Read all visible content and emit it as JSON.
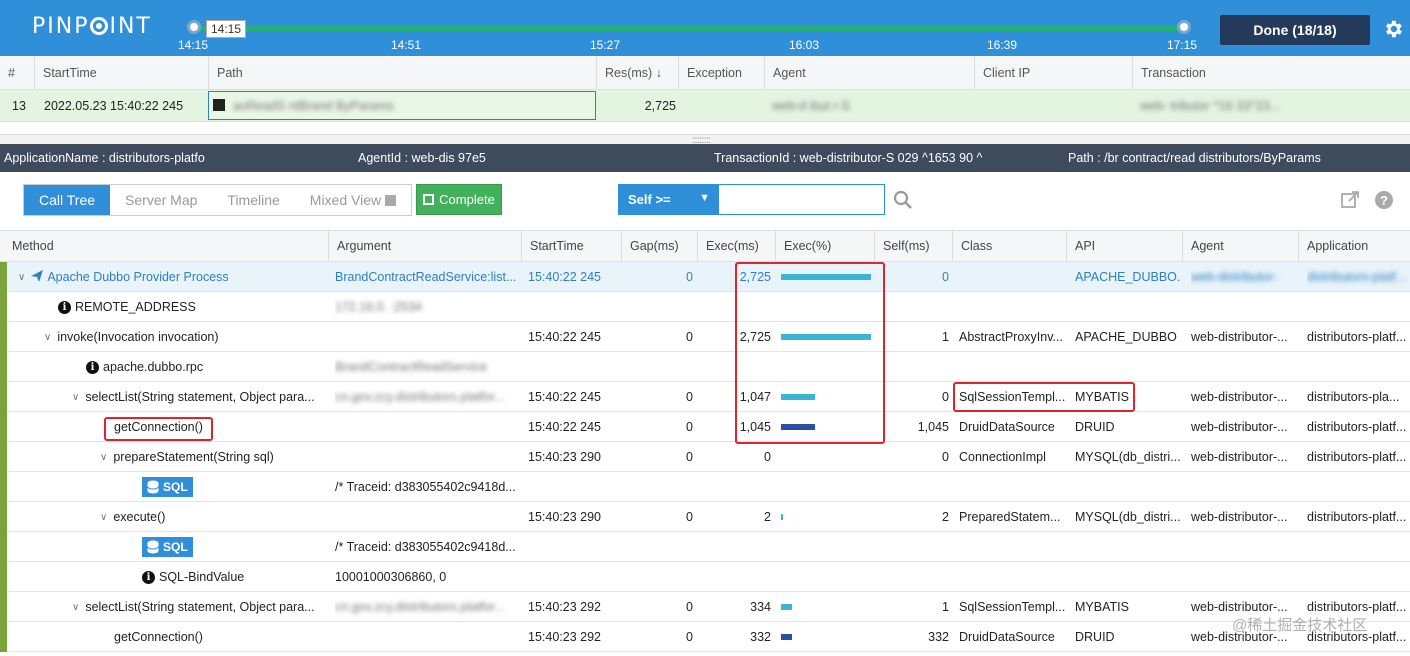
{
  "app": {
    "logo": "PINPOINT",
    "timeline": {
      "handle_label": "14:15",
      "ticks": [
        "14:15",
        "14:51",
        "15:27",
        "16:03",
        "16:39",
        "17:15"
      ]
    },
    "done_button": "Done (18/18)",
    "settings_icon": "gear-icon"
  },
  "transactions": {
    "headers": [
      "#",
      "StartTime",
      "Path",
      "Res(ms) ↓",
      "Exception",
      "Agent",
      "Client IP",
      "Transaction"
    ],
    "row": {
      "index": "13",
      "start_time": "2022.05.23 15:40:22 245",
      "path": "aoReadS        ntBrand   ByParams",
      "res_ms": "2,725",
      "exception": "",
      "agent": "web-d        ibut   r-S",
      "client_ip": "",
      "transaction": "web-        tributor                ^16           33^23..."
    }
  },
  "infobar": {
    "application_name": "ApplicationName : distributors-platfo",
    "agent_id": "AgentId : web-dis              97e5",
    "transaction_id": "TransactionId : web-distributor-S 029    ^1653     90    ^",
    "path": "Path : /br     contract/read      distributors/ByParams"
  },
  "toolbar": {
    "tabs": [
      "Call Tree",
      "Server Map",
      "Timeline",
      "Mixed View"
    ],
    "active_tab": "Call Tree",
    "complete_button": "Complete",
    "filter_select": "Self >=",
    "filter_input_value": ""
  },
  "calltree": {
    "headers": [
      "Method",
      "Argument",
      "StartTime",
      "Gap(ms)",
      "Exec(ms)",
      "Exec(%)",
      "Self(ms)",
      "Class",
      "API",
      "Agent",
      "Application"
    ],
    "rows": [
      {
        "method": "Apache Dubbo Provider Process",
        "argument": "BrandContractReadService:list...",
        "start": "15:40:22 245",
        "gap": "0",
        "exec": "2,725",
        "pct": 100,
        "self": "0",
        "class": "",
        "api": "APACHE_DUBBO...",
        "agent": "web-distributor-",
        "app": "distributors-platf..."
      },
      {
        "method": "REMOTE_ADDRESS",
        "argument": "172.16.0.   :2534",
        "start": "",
        "gap": "",
        "exec": "",
        "pct": 0,
        "self": "",
        "class": "",
        "api": "",
        "agent": "",
        "app": ""
      },
      {
        "method": "invoke(Invocation invocation)",
        "argument": "",
        "start": "15:40:22 245",
        "gap": "0",
        "exec": "2,725",
        "pct": 100,
        "self": "1",
        "class": "AbstractProxyInv...",
        "api": "APACHE_DUBBO",
        "agent": "web-distributor-...",
        "app": "distributors-platf..."
      },
      {
        "method": "apache.dubbo.rpc",
        "argument": "BrandContractReadService",
        "start": "",
        "gap": "",
        "exec": "",
        "pct": 0,
        "self": "",
        "class": "",
        "api": "",
        "agent": "",
        "app": ""
      },
      {
        "method": "selectList(String statement, Object para...",
        "argument": "cn.gov.zcy.distributors.platfor...",
        "start": "15:40:22 245",
        "gap": "0",
        "exec": "1,047",
        "pct": 38,
        "self": "0",
        "class": "SqlSessionTempl...",
        "api": "MYBATIS",
        "agent": "web-distributor-...",
        "app": "distributors-pla..."
      },
      {
        "method": "getConnection()",
        "argument": "",
        "start": "15:40:22 245",
        "gap": "0",
        "exec": "1,045",
        "pct": 38,
        "self": "1,045",
        "class": "DruidDataSource",
        "api": "DRUID",
        "agent": "web-distributor-...",
        "app": "distributors-platf..."
      },
      {
        "method": "prepareStatement(String sql)",
        "argument": "",
        "start": "15:40:23 290",
        "gap": "0",
        "exec": "0",
        "pct": 0,
        "self": "0",
        "class": "ConnectionImpl",
        "api": "MYSQL(db_distri...",
        "agent": "web-distributor-...",
        "app": "distributors-platf..."
      },
      {
        "method": "SQL",
        "argument": "/* Traceid: d383055402c9418d...",
        "start": "",
        "gap": "",
        "exec": "",
        "pct": 0,
        "self": "",
        "class": "",
        "api": "",
        "agent": "",
        "app": ""
      },
      {
        "method": "execute()",
        "argument": "",
        "start": "15:40:23 290",
        "gap": "0",
        "exec": "2",
        "pct": 0.1,
        "self": "2",
        "class": "PreparedStatem...",
        "api": "MYSQL(db_distri...",
        "agent": "web-distributor-...",
        "app": "distributors-platf..."
      },
      {
        "method": "SQL",
        "argument": "/* Traceid: d383055402c9418d...",
        "start": "",
        "gap": "",
        "exec": "",
        "pct": 0,
        "self": "",
        "class": "",
        "api": "",
        "agent": "",
        "app": ""
      },
      {
        "method": "SQL-BindValue",
        "argument": "10001000306860, 0",
        "start": "",
        "gap": "",
        "exec": "",
        "pct": 0,
        "self": "",
        "class": "",
        "api": "",
        "agent": "",
        "app": ""
      },
      {
        "method": "selectList(String statement, Object para...",
        "argument": "cn.gov.zcy.distributors.platfor...",
        "start": "15:40:23 292",
        "gap": "0",
        "exec": "334",
        "pct": 12,
        "self": "1",
        "class": "SqlSessionTempl...",
        "api": "MYBATIS",
        "agent": "web-distributor-...",
        "app": "distributors-platf..."
      },
      {
        "method": "getConnection()",
        "argument": "",
        "start": "15:40:23 292",
        "gap": "0",
        "exec": "332",
        "pct": 12,
        "self": "332",
        "class": "DruidDataSource",
        "api": "DRUID",
        "agent": "web-distributor-...",
        "app": "distributors-platf..."
      }
    ]
  },
  "watermark": "@稀土掘金技术社区",
  "colors": {
    "topbar": "#2f8fd8",
    "bar_light": "#3ab5d4",
    "bar_dark": "#2b4fa8",
    "highlight": "#e0242e"
  }
}
